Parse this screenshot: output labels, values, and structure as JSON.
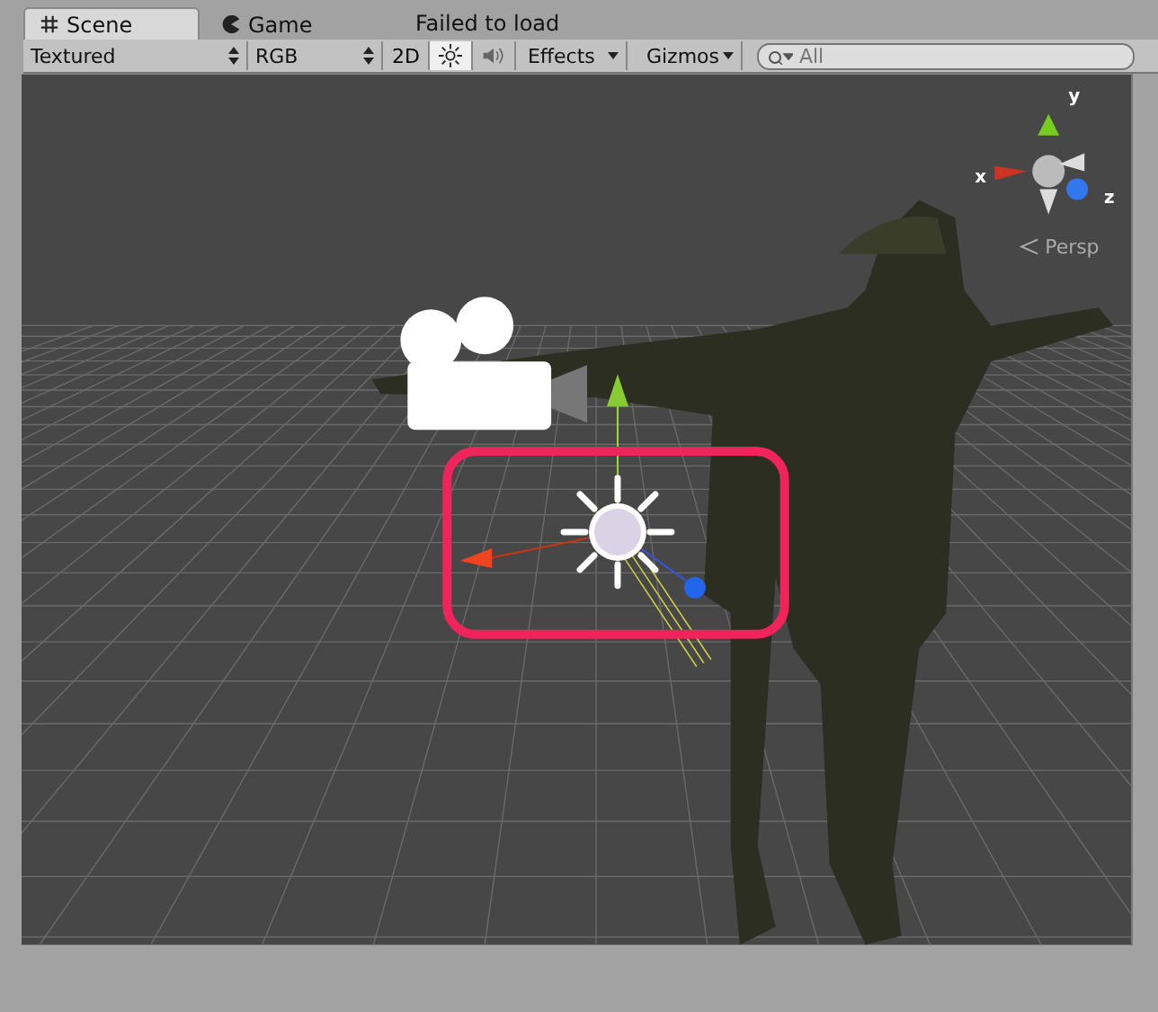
{
  "tabs": [
    {
      "label": "Scene",
      "kind": "scene",
      "selected": true
    },
    {
      "label": "Game",
      "kind": "game",
      "selected": false
    }
  ],
  "status": "Failed to load",
  "toolbar": {
    "shading": "Textured",
    "channel": "RGB",
    "mode_2d": {
      "label": "2D",
      "on": false
    },
    "lighting": {
      "on": true
    },
    "audio": {
      "on": false
    },
    "effects": "Effects",
    "gizmos": "Gizmos",
    "search": {
      "placeholder": "All"
    }
  },
  "scene_gizmo": {
    "axes": [
      {
        "label": "y",
        "kind": "y"
      },
      {
        "label": "x",
        "kind": "x"
      },
      {
        "label": "z",
        "kind": "z"
      }
    ],
    "projection": "Persp"
  },
  "highlight": {
    "color": "#f0245a"
  }
}
